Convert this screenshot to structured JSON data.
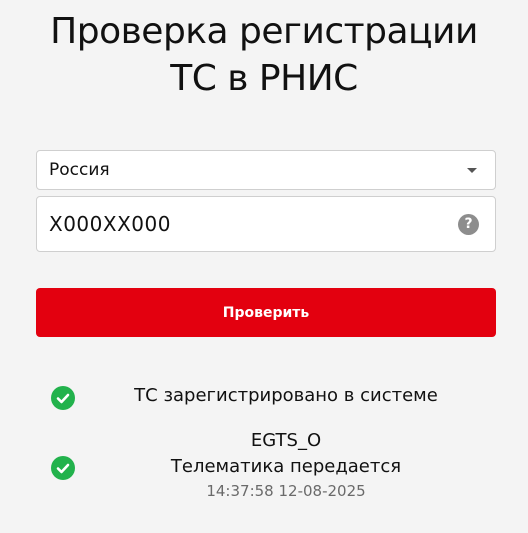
{
  "title": {
    "line1": "Проверка регистрации",
    "line2": "ТС в РНИС"
  },
  "form": {
    "country": {
      "selected": "Россия",
      "icon": "chevron-down-icon"
    },
    "plate": {
      "placeholder": "Х000ХХ000",
      "value": "",
      "help_icon": "question-icon",
      "help_symbol": "?"
    },
    "submit_label": "Проверить"
  },
  "results": [
    {
      "icon": "check-circle-icon",
      "text": "ТС зарегистрировано в системе"
    },
    {
      "icon": "check-circle-icon",
      "protocol": "EGTS_O",
      "text": "Телематика передается",
      "timestamp": "14:37:58 12-08-2025"
    }
  ],
  "colors": {
    "accent": "#e3000f",
    "success": "#22b24c",
    "background": "#f4f4f4",
    "muted_text": "#6a6a6a"
  }
}
